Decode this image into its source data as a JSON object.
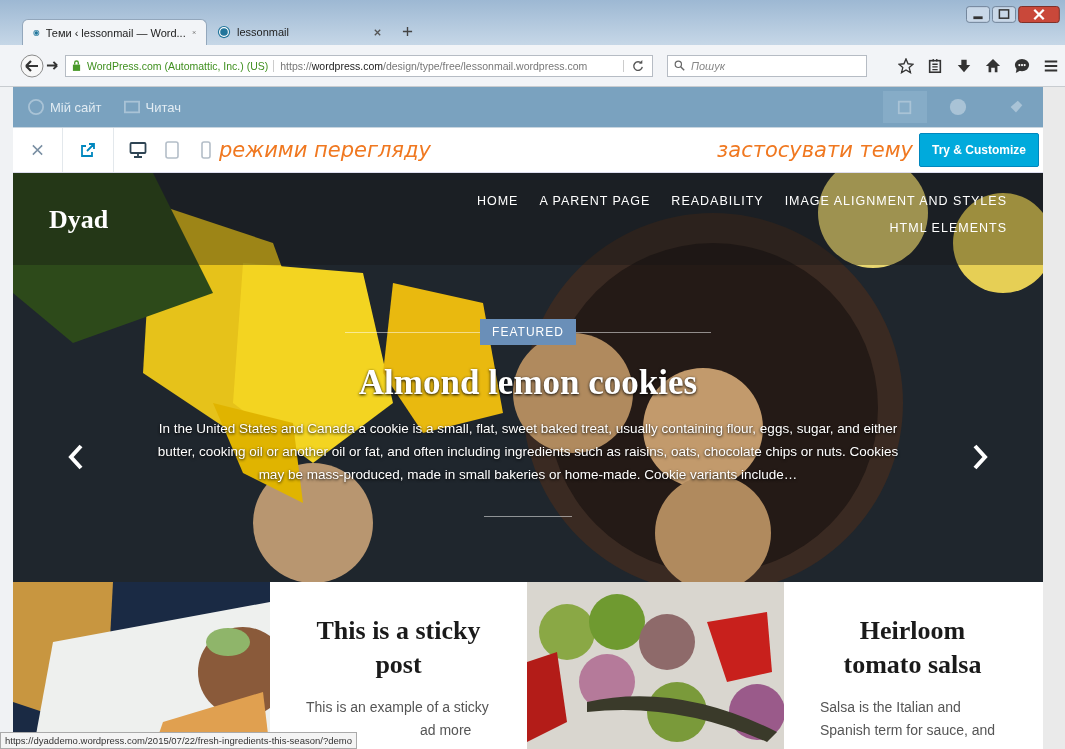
{
  "browser": {
    "tabs": [
      {
        "title": "Теми ‹ lessonmail — Word...",
        "selected": true
      },
      {
        "title": "lessonmail",
        "selected": false
      }
    ],
    "identity": "WordPress.com (Automattic, Inc.) (US)",
    "url_scheme": "https://",
    "url_domain": "wordpress.com",
    "url_path": "/design/type/free/lessonmail.wordpress.com",
    "search_placeholder": "Пошук",
    "status_url": "https://dyaddemo.wordpress.com/2015/07/22/fresh-ingredients-this-season/?demo"
  },
  "admin_bar": {
    "items": [
      "Мій сайт",
      "Читач"
    ]
  },
  "preview_toolbar": {
    "devices": [
      {
        "kind": "desktop",
        "selected": true
      },
      {
        "kind": "tablet",
        "selected": false
      },
      {
        "kind": "phone",
        "selected": false
      }
    ],
    "annotation_left": "режими перегляду",
    "annotation_right": "застосувати тему",
    "button": "Try & Customize"
  },
  "site": {
    "title": "Dyad",
    "menu": [
      "HOME",
      "A PARENT PAGE",
      "READABILITY",
      "IMAGE ALIGNMENT AND STYLES",
      "HTML ELEMENTS"
    ],
    "featured": {
      "badge": "FEATURED",
      "title": "Almond lemon cookies",
      "excerpt": "In the United States and Canada a cookie is a small, flat, sweet baked treat, usually containing flour, eggs, sugar, and either butter, cooking oil or another oil or fat, and often including ingredients such as raisins, oats, chocolate chips or nuts. Cookies may be mass-produced, made in small bakeries or home-made. Cookie variants include…"
    }
  },
  "cards": [
    {
      "kind": "picture"
    },
    {
      "kind": "post",
      "title": "This is a sticky post",
      "lines": [
        "This is an example of a sticky",
        "ad more"
      ]
    },
    {
      "kind": "picture"
    },
    {
      "kind": "post",
      "title": "Heirloom tomato salsa",
      "lines": [
        "Salsa is the Italian and",
        "Spanish term for sauce, and"
      ]
    }
  ]
}
